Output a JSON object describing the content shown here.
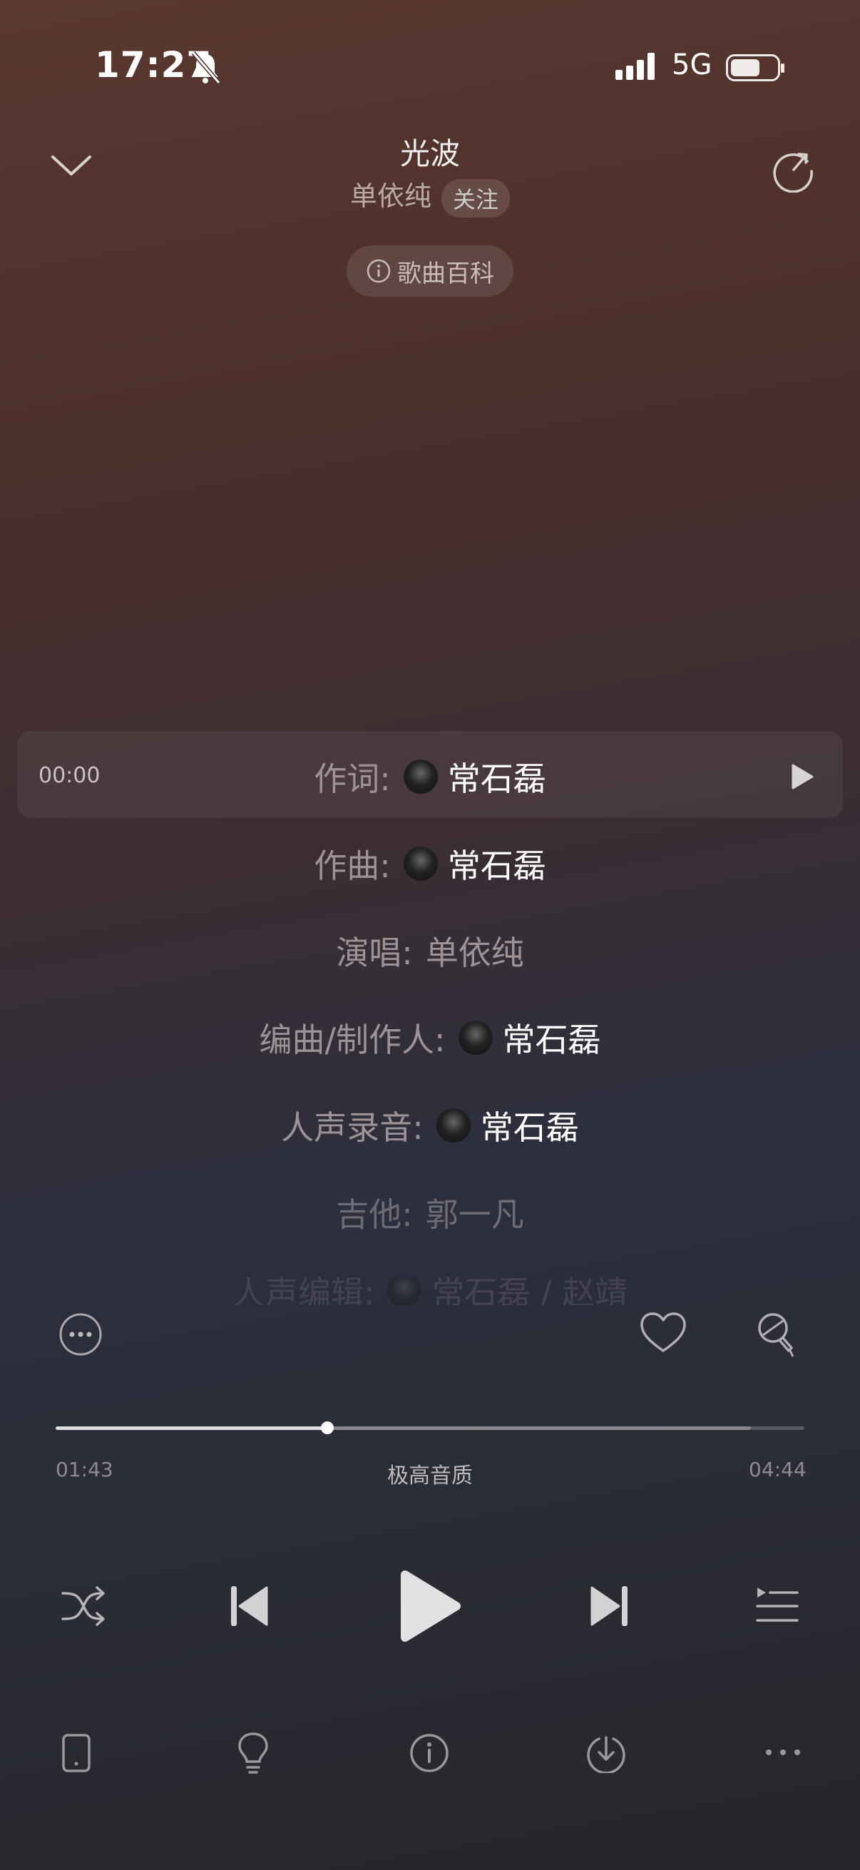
{
  "status_bar": {
    "time": "17:27",
    "network": "5G"
  },
  "header": {
    "title": "光波",
    "artist": "单依纯",
    "follow_label": "关注",
    "wiki_label": "歌曲百科"
  },
  "credits": {
    "current_time": "00:00",
    "rows": [
      {
        "role": "作词:",
        "name": "常石磊"
      },
      {
        "role": "作曲:",
        "name": "常石磊"
      },
      {
        "role": "演唱:",
        "name": "单依纯"
      },
      {
        "role": "编曲/制作人:",
        "name": "常石磊"
      },
      {
        "role": "人声录音:",
        "name": "常石磊"
      },
      {
        "role": "吉他:",
        "name": "郭一凡"
      },
      {
        "role": "人声编辑:",
        "name": "常石磊 / 赵靖"
      }
    ]
  },
  "player": {
    "elapsed": "01:43",
    "duration": "04:44",
    "quality": "极高音质",
    "progress_fraction": 0.363
  },
  "icons": {
    "top_left": "chevron-down-icon",
    "top_right": "share-icon",
    "actions": [
      "more-options-icon",
      "heart-icon",
      "karaoke-mic-icon"
    ],
    "controls": [
      "shuffle-icon",
      "previous-icon",
      "play-icon",
      "next-icon",
      "playlist-icon"
    ],
    "bottom": [
      "device-icon",
      "lightbulb-icon",
      "info-icon",
      "download-icon",
      "more-icon"
    ]
  }
}
